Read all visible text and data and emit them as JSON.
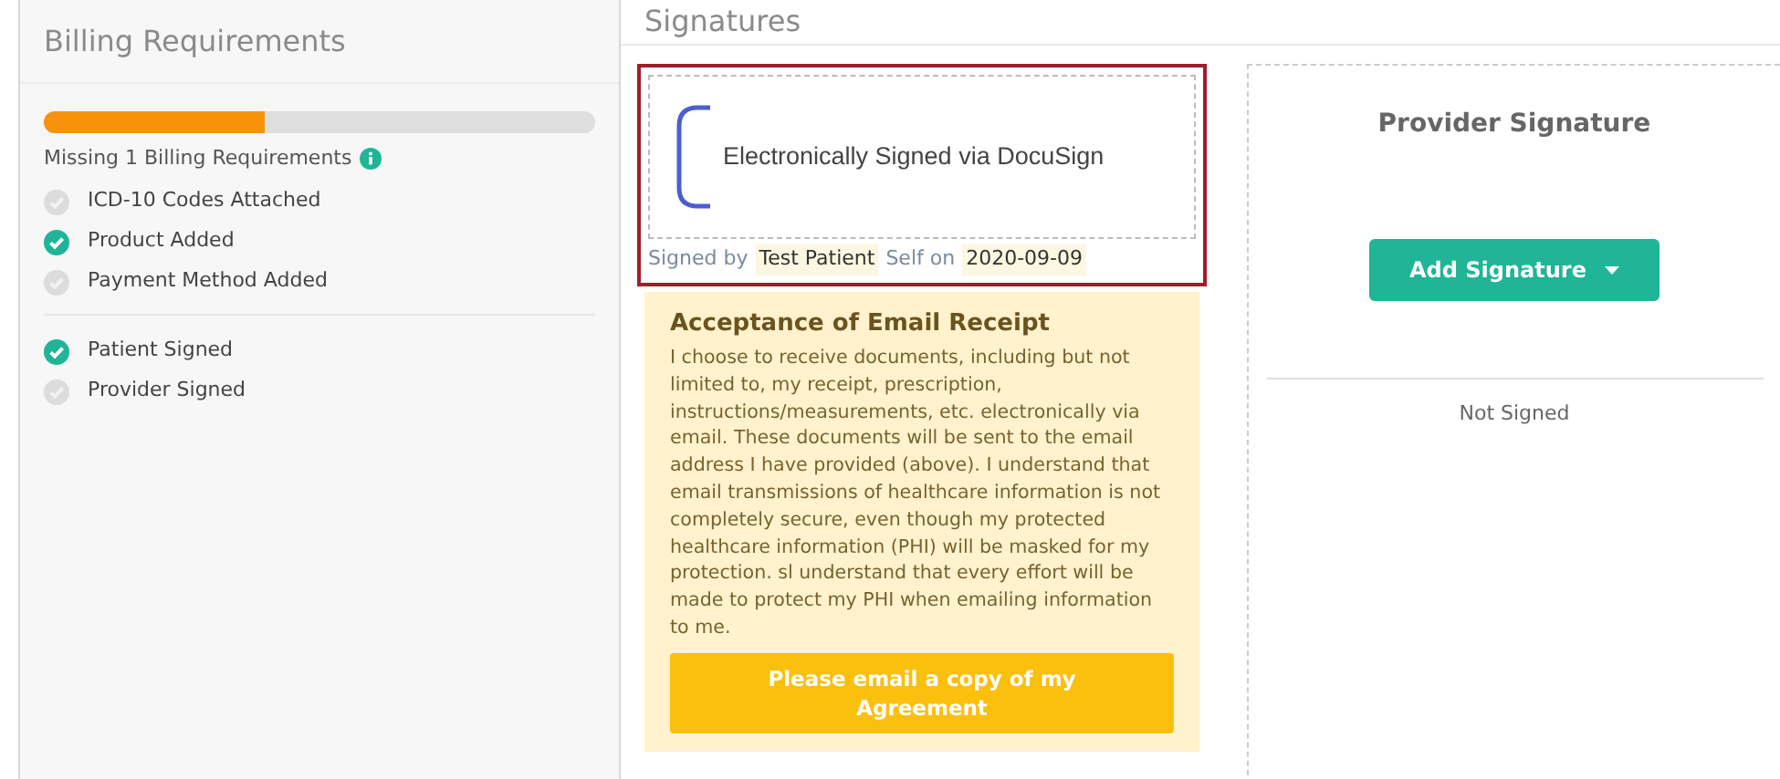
{
  "billing": {
    "title": "Billing Requirements",
    "progress": {
      "level": 0.4
    },
    "summary": "Missing 1 Billing Requirements",
    "groups": [
      [
        {
          "label": "ICD-10 Codes Attached",
          "checked": false
        },
        {
          "label": "Product Added",
          "checked": true
        },
        {
          "label": "Payment Method Added",
          "checked": false
        }
      ],
      [
        {
          "label": "Patient Signed",
          "checked": true
        },
        {
          "label": "Provider Signed",
          "checked": false
        }
      ]
    ]
  },
  "signatures": {
    "title": "Signatures",
    "patient": {
      "highlighted": true,
      "signature_text": "Electronically Signed via DocuSign",
      "signed_by_label": "Signed by",
      "signer": "Test Patient",
      "role_label": "Self on",
      "date": "2020-09-09"
    },
    "consent": {
      "title": "Acceptance of Email Receipt",
      "body": "I choose to receive documents, including but not limited to, my receipt, prescription, instructions/measurements, etc. electronically via email. These documents will be sent to the email address I have provided (above). I understand that email transmissions of healthcare information is not completely secure, even though my protected healthcare information (PHI) will be masked for my protection. sl understand that every effort will be made to protect my PHI when emailing information to me.",
      "button": "Please email a copy of my Agreement"
    },
    "provider": {
      "title": "Provider Signature",
      "button": "Add Signature",
      "status": "Not Signed"
    }
  }
}
